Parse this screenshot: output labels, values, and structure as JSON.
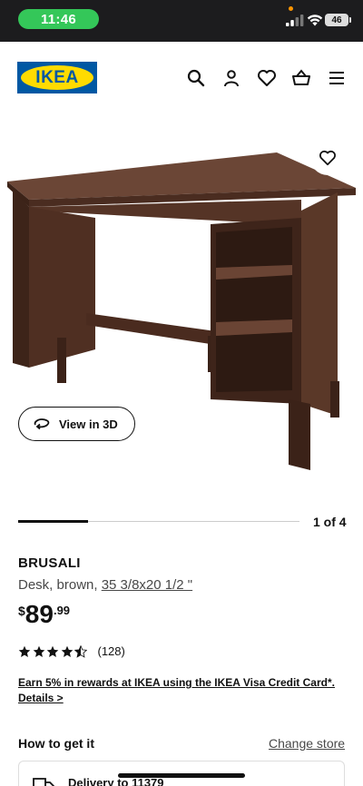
{
  "status_bar": {
    "time": "11:46",
    "battery": "46",
    "icons": [
      "signal-icon",
      "wifi-icon",
      "battery-icon"
    ]
  },
  "header": {
    "logo_text": "IKEA",
    "icons": [
      "search-icon",
      "profile-icon",
      "wishlist-icon",
      "cart-icon",
      "menu-icon"
    ]
  },
  "gallery": {
    "view_3d_label": "View in 3D",
    "pager_text": "1 of 4",
    "current_index": 1,
    "total": 4
  },
  "product": {
    "name": "BRUSALI",
    "description_prefix": "Desk, brown, ",
    "size_link": "35 3/8x20 1/2 \"",
    "price_currency": "$",
    "price_integer": "89",
    "price_decimal": ".99",
    "rating_value": 4.5,
    "rating_max": 5,
    "rating_count": "(128)"
  },
  "promo": {
    "text": "Earn 5% in rewards at IKEA using the IKEA Visa Credit Card*.",
    "details_link": "Details >"
  },
  "fulfillment": {
    "title": "How to get it",
    "change_store_label": "Change store",
    "delivery_text": "Delivery to 11379"
  },
  "colors": {
    "ikea_blue": "#0058a3",
    "ikea_yellow": "#ffdb00",
    "status_green": "#34c759",
    "desk_brown": "#5a3a2c"
  }
}
